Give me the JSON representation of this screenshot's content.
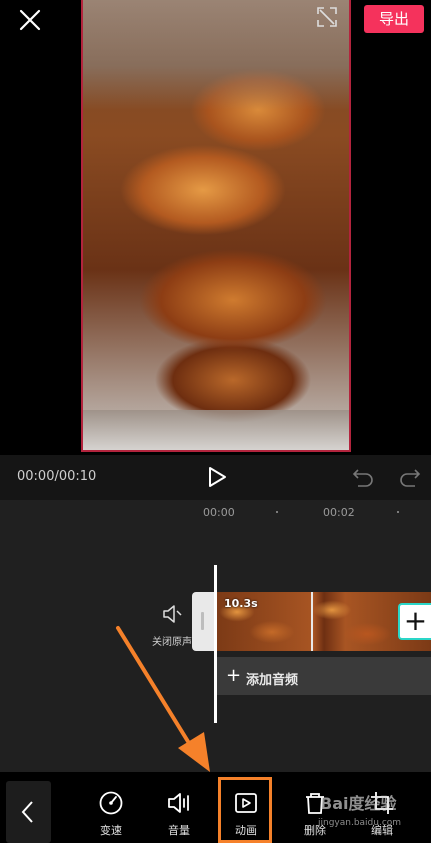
{
  "header": {
    "export_label": "导出"
  },
  "player": {
    "timecode": "00:00/00:10"
  },
  "timeline": {
    "ticks": [
      "00:00",
      "00:02"
    ],
    "mute_label": "关闭原声",
    "clip_duration": "10.3s",
    "add_clip_label": "+",
    "add_audio_plus": "+",
    "add_audio_label": "添加音频"
  },
  "toolbar": {
    "tools": [
      {
        "label": "变速",
        "icon": "speed-gauge-icon"
      },
      {
        "label": "音量",
        "icon": "volume-icon"
      },
      {
        "label": "动画",
        "icon": "animation-play-icon"
      },
      {
        "label": "删除",
        "icon": "delete-icon"
      },
      {
        "label": "编辑",
        "icon": "edit-crop-icon"
      }
    ]
  },
  "watermark": {
    "logo": "Bai度经验",
    "url": "jingyan.baidu.com"
  },
  "colors": {
    "accent": "#f5325c",
    "highlight": "#f5812a",
    "clip_handle": "#2ad6c8"
  }
}
